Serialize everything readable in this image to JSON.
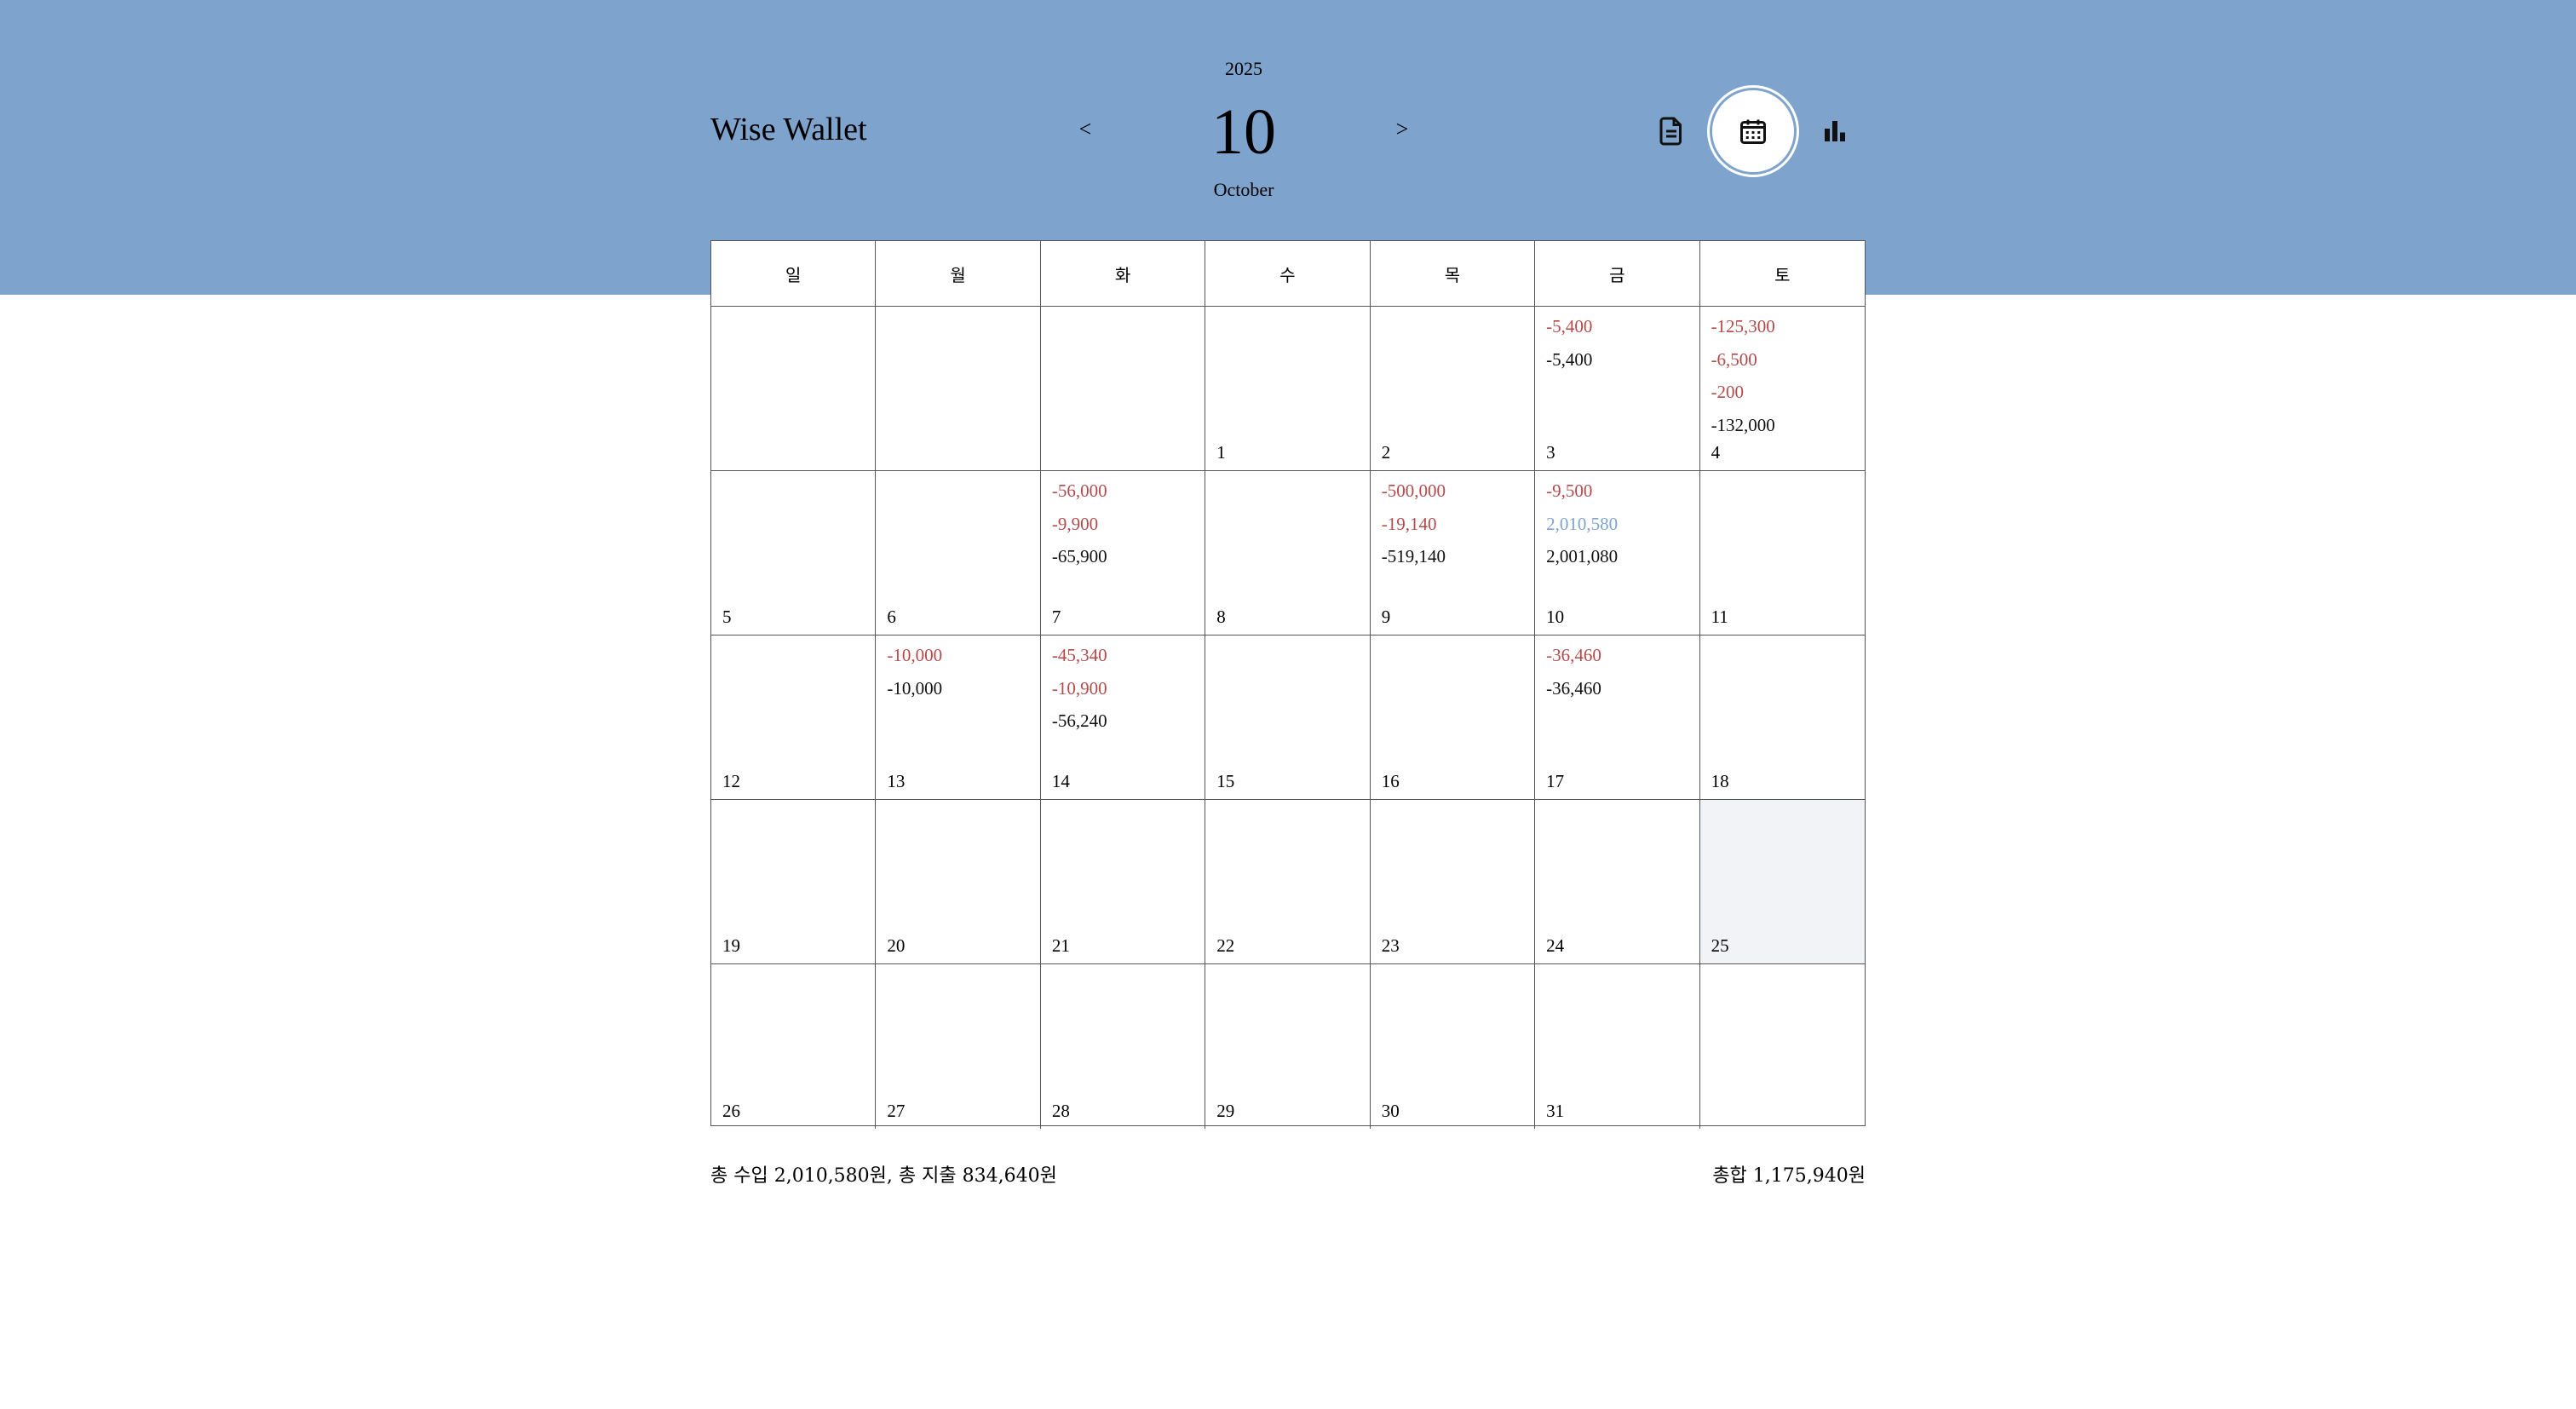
{
  "app": {
    "title": "Wise Wallet"
  },
  "month_nav": {
    "prev_label": "<",
    "next_label": ">",
    "year": "2025",
    "month_number": "10",
    "month_name": "October"
  },
  "view_buttons": [
    {
      "icon": "document-icon",
      "active": false
    },
    {
      "icon": "calendar-icon",
      "active": true
    },
    {
      "icon": "bar-chart-icon",
      "active": false
    }
  ],
  "colors": {
    "header": "#7ea3cc",
    "expense": "#b44a4a",
    "income": "#7ea3cc",
    "today": "#f2f3f7"
  },
  "weekdays": [
    "일",
    "월",
    "화",
    "수",
    "목",
    "금",
    "토"
  ],
  "days": [
    {
      "day": "",
      "entries": []
    },
    {
      "day": "",
      "entries": []
    },
    {
      "day": "",
      "entries": []
    },
    {
      "day": "1",
      "entries": []
    },
    {
      "day": "2",
      "entries": []
    },
    {
      "day": "3",
      "entries": [
        [
          "-5,400",
          "exp"
        ],
        [
          "-5,400",
          "sum"
        ]
      ]
    },
    {
      "day": "4",
      "entries": [
        [
          "-125,300",
          "exp"
        ],
        [
          "-6,500",
          "exp"
        ],
        [
          "-200",
          "exp"
        ],
        [
          "-132,000",
          "sum"
        ]
      ]
    },
    {
      "day": "5",
      "entries": []
    },
    {
      "day": "6",
      "entries": []
    },
    {
      "day": "7",
      "entries": [
        [
          "-56,000",
          "exp"
        ],
        [
          "-9,900",
          "exp"
        ],
        [
          "-65,900",
          "sum"
        ]
      ]
    },
    {
      "day": "8",
      "entries": []
    },
    {
      "day": "9",
      "entries": [
        [
          "-500,000",
          "exp"
        ],
        [
          "-19,140",
          "exp"
        ],
        [
          "-519,140",
          "sum"
        ]
      ]
    },
    {
      "day": "10",
      "entries": [
        [
          "-9,500",
          "exp"
        ],
        [
          "2,010,580",
          "inc"
        ],
        [
          "2,001,080",
          "sum"
        ]
      ]
    },
    {
      "day": "11",
      "entries": []
    },
    {
      "day": "12",
      "entries": []
    },
    {
      "day": "13",
      "entries": [
        [
          "-10,000",
          "exp"
        ],
        [
          "-10,000",
          "sum"
        ]
      ]
    },
    {
      "day": "14",
      "entries": [
        [
          "-45,340",
          "exp"
        ],
        [
          "-10,900",
          "exp"
        ],
        [
          "-56,240",
          "sum"
        ]
      ]
    },
    {
      "day": "15",
      "entries": []
    },
    {
      "day": "16",
      "entries": []
    },
    {
      "day": "17",
      "entries": [
        [
          "-36,460",
          "exp"
        ],
        [
          "-36,460",
          "sum"
        ]
      ]
    },
    {
      "day": "18",
      "entries": []
    },
    {
      "day": "19",
      "entries": []
    },
    {
      "day": "20",
      "entries": []
    },
    {
      "day": "21",
      "entries": []
    },
    {
      "day": "22",
      "entries": []
    },
    {
      "day": "23",
      "entries": []
    },
    {
      "day": "24",
      "entries": []
    },
    {
      "day": "25",
      "entries": [],
      "today": true
    },
    {
      "day": "26",
      "entries": []
    },
    {
      "day": "27",
      "entries": []
    },
    {
      "day": "28",
      "entries": []
    },
    {
      "day": "29",
      "entries": []
    },
    {
      "day": "30",
      "entries": []
    },
    {
      "day": "31",
      "entries": []
    },
    {
      "day": "",
      "entries": []
    }
  ],
  "footer": {
    "summary": "총 수입 2,010,580원, 총 지출 834,640원",
    "total": "총합 1,175,940원"
  }
}
